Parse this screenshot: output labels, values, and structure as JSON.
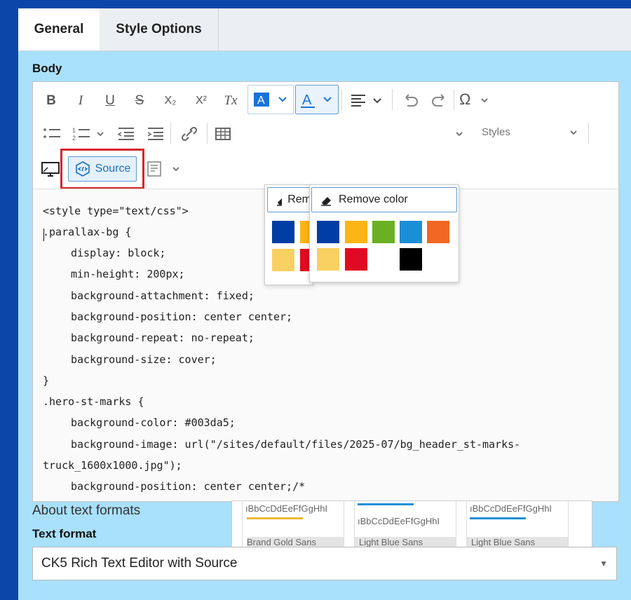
{
  "tabs": [
    {
      "label": "General"
    },
    {
      "label": "Style Options"
    }
  ],
  "body_label": "Body",
  "toolbar": {
    "bold": "B",
    "italic": "I",
    "underline": "U",
    "strike": "S",
    "subscript": "X₂",
    "superscript": "X²",
    "remove_format": "Tx",
    "source_label": "Source",
    "styles_label": "Styles",
    "special_chars": "Ω"
  },
  "font_color_dropdown": {
    "remove_label": "Remove color",
    "colors": [
      "#003da5",
      "#fdb515",
      "#6ab023",
      "#1a8fd6",
      "#f26722",
      "#f8d162",
      "#e00b22",
      "#ffffff",
      "#000000"
    ]
  },
  "bg_color_dropdown": {
    "remove_label": "Rem",
    "colors": [
      "#003da5",
      "#fdb515",
      "#f8d162",
      "#e00b22"
    ]
  },
  "code_lines": [
    "<style type=\"text/css\">",
    ".parallax-bg {",
    "display: block;",
    "min-height: 200px;",
    "background-attachment: fixed;",
    "background-position: center center;",
    "background-repeat: no-repeat;",
    "background-size: cover;",
    "}",
    ".hero-st-marks {",
    "background-color: #003da5;",
    "background-image: url(\"/sites/default/files/2025-07/bg_header_st-marks-",
    "truck_1600x1000.jpg\");",
    "background-position: center center;/*"
  ],
  "styles_preview": {
    "sample": "ıBbCcDdEeFfGgHhI",
    "items": [
      "Brand Gold Sans",
      "Light Blue Sans",
      "Light Blue Sans"
    ]
  },
  "about_text_formats": "About text formats",
  "text_format_label": "Text format",
  "text_format_value": "CK5 Rich Text Editor with Source"
}
